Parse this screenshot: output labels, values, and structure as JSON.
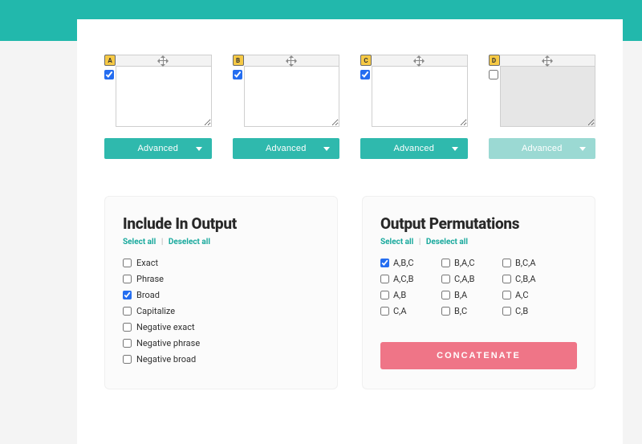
{
  "columns": [
    {
      "badge": "A",
      "checked": true,
      "enabled": true,
      "advanced_label": "Advanced",
      "value": ""
    },
    {
      "badge": "B",
      "checked": true,
      "enabled": true,
      "advanced_label": "Advanced",
      "value": ""
    },
    {
      "badge": "C",
      "checked": true,
      "enabled": true,
      "advanced_label": "Advanced",
      "value": ""
    },
    {
      "badge": "D",
      "checked": false,
      "enabled": false,
      "advanced_label": "Advanced",
      "value": ""
    }
  ],
  "include_panel": {
    "title": "Include In Output",
    "select_all": "Select all",
    "deselect_all": "Deselect all",
    "options": [
      {
        "label": "Exact",
        "checked": false
      },
      {
        "label": "Phrase",
        "checked": false
      },
      {
        "label": "Broad",
        "checked": true
      },
      {
        "label": "Capitalize",
        "checked": false
      },
      {
        "label": "Negative exact",
        "checked": false
      },
      {
        "label": "Negative phrase",
        "checked": false
      },
      {
        "label": "Negative broad",
        "checked": false
      }
    ]
  },
  "perm_panel": {
    "title": "Output Permutations",
    "select_all": "Select all",
    "deselect_all": "Deselect all",
    "rows": [
      [
        {
          "label": "A,B,C",
          "checked": true
        },
        {
          "label": "B,A,C",
          "checked": false
        },
        {
          "label": "B,C,A",
          "checked": false
        }
      ],
      [
        {
          "label": "A,C,B",
          "checked": false
        },
        {
          "label": "C,A,B",
          "checked": false
        },
        {
          "label": "C,B,A",
          "checked": false
        }
      ],
      [
        {
          "label": "A,B",
          "checked": false
        },
        {
          "label": "B,A",
          "checked": false
        },
        {
          "label": "A,C",
          "checked": false
        }
      ],
      [
        {
          "label": "C,A",
          "checked": false
        },
        {
          "label": "B,C",
          "checked": false
        },
        {
          "label": "C,B",
          "checked": false
        }
      ]
    ],
    "concatenate_label": "CONCATENATE"
  }
}
